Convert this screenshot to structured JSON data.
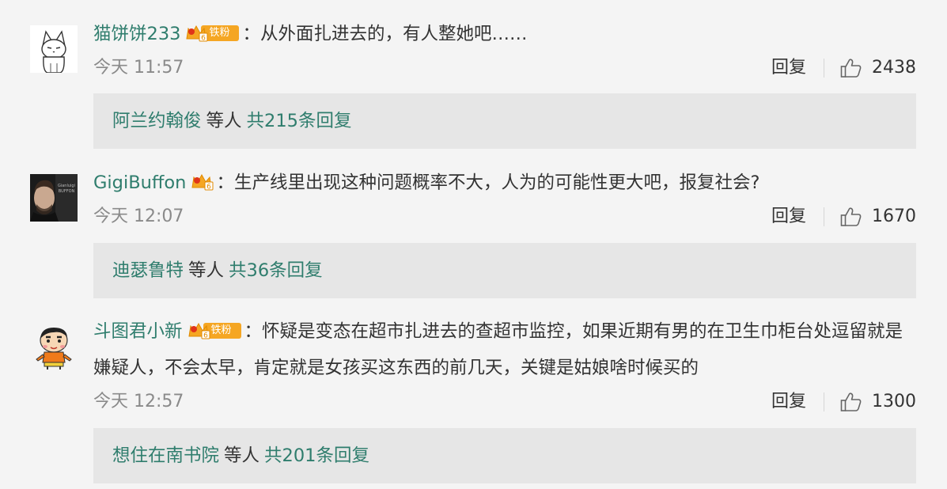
{
  "comments": [
    {
      "username": "猫饼饼233",
      "badge": "铁粉",
      "text": "从外面扎进去的，有人整她吧……",
      "time": "今天 11:57",
      "reply_label": "回复",
      "likes": "2438",
      "reply_summary": {
        "users": "阿兰约翰俊",
        "etc": "等人",
        "total": "共215条回复"
      }
    },
    {
      "username": "GigiBuffon",
      "badge": "",
      "text": "生产线里出现这种问题概率不大，人为的可能性更大吧，报复社会?",
      "time": "今天 12:07",
      "reply_label": "回复",
      "likes": "1670",
      "reply_summary": {
        "users": "迪瑟鲁特",
        "etc": "等人",
        "total": "共36条回复"
      }
    },
    {
      "username": "斗图君小新",
      "badge": "铁粉",
      "text": "怀疑是变态在超市扎进去的查超市监控，如果近期有男的在卫生巾柜台处逗留就是嫌疑人，不会太早，肯定就是女孩买这东西的前几天，关键是姑娘啥时候买的",
      "time": "今天 12:57",
      "reply_label": "回复",
      "likes": "1300",
      "reply_summary": {
        "users": "想住在南书院",
        "etc": "等人",
        "total": "共201条回复"
      }
    }
  ],
  "colon": "：",
  "icons": {
    "avatar_1": "cat-avatar-icon",
    "avatar_2": "man-portrait-avatar-icon",
    "avatar_3": "crayon-shinchan-avatar-icon",
    "badge": "crown-fan-badge-icon",
    "like": "thumbs-up-icon"
  },
  "colors": {
    "username": "#2f7d6d",
    "badge": "#f5a623",
    "background": "#f4f4f4",
    "reply_box": "#e6e6e6"
  }
}
